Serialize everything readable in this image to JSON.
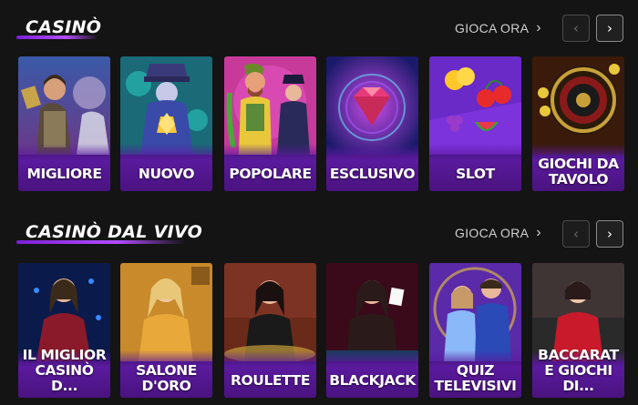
{
  "casino": {
    "title": "CASINÒ",
    "play_link": "GIOCA ORA",
    "cards": [
      {
        "label": "MIGLIORE"
      },
      {
        "label": "NUOVO"
      },
      {
        "label": "POPOLARE"
      },
      {
        "label": "ESCLUSIVO"
      },
      {
        "label": "SLOT"
      },
      {
        "label": "GIOCHI DA TAVOLO"
      }
    ]
  },
  "live": {
    "title": "CASINÒ DAL VIVO",
    "play_link": "GIOCA ORA",
    "cards": [
      {
        "label": "IL MIGLIOR CASINÒ D..."
      },
      {
        "label": "SALONE D'ORO"
      },
      {
        "label": "ROULETTE"
      },
      {
        "label": "BLACKJACK"
      },
      {
        "label": "QUIZ TELEVISIVI"
      },
      {
        "label": "BACCARAT E GIOCHI DI..."
      }
    ]
  },
  "colors": {
    "background": "#141414",
    "accent_purple": "#5a1a9e",
    "underline": "#b44cff"
  },
  "icons": {
    "chevron": "chevron-right-icon",
    "prev": "chevron-left-icon",
    "next": "chevron-right-icon"
  }
}
